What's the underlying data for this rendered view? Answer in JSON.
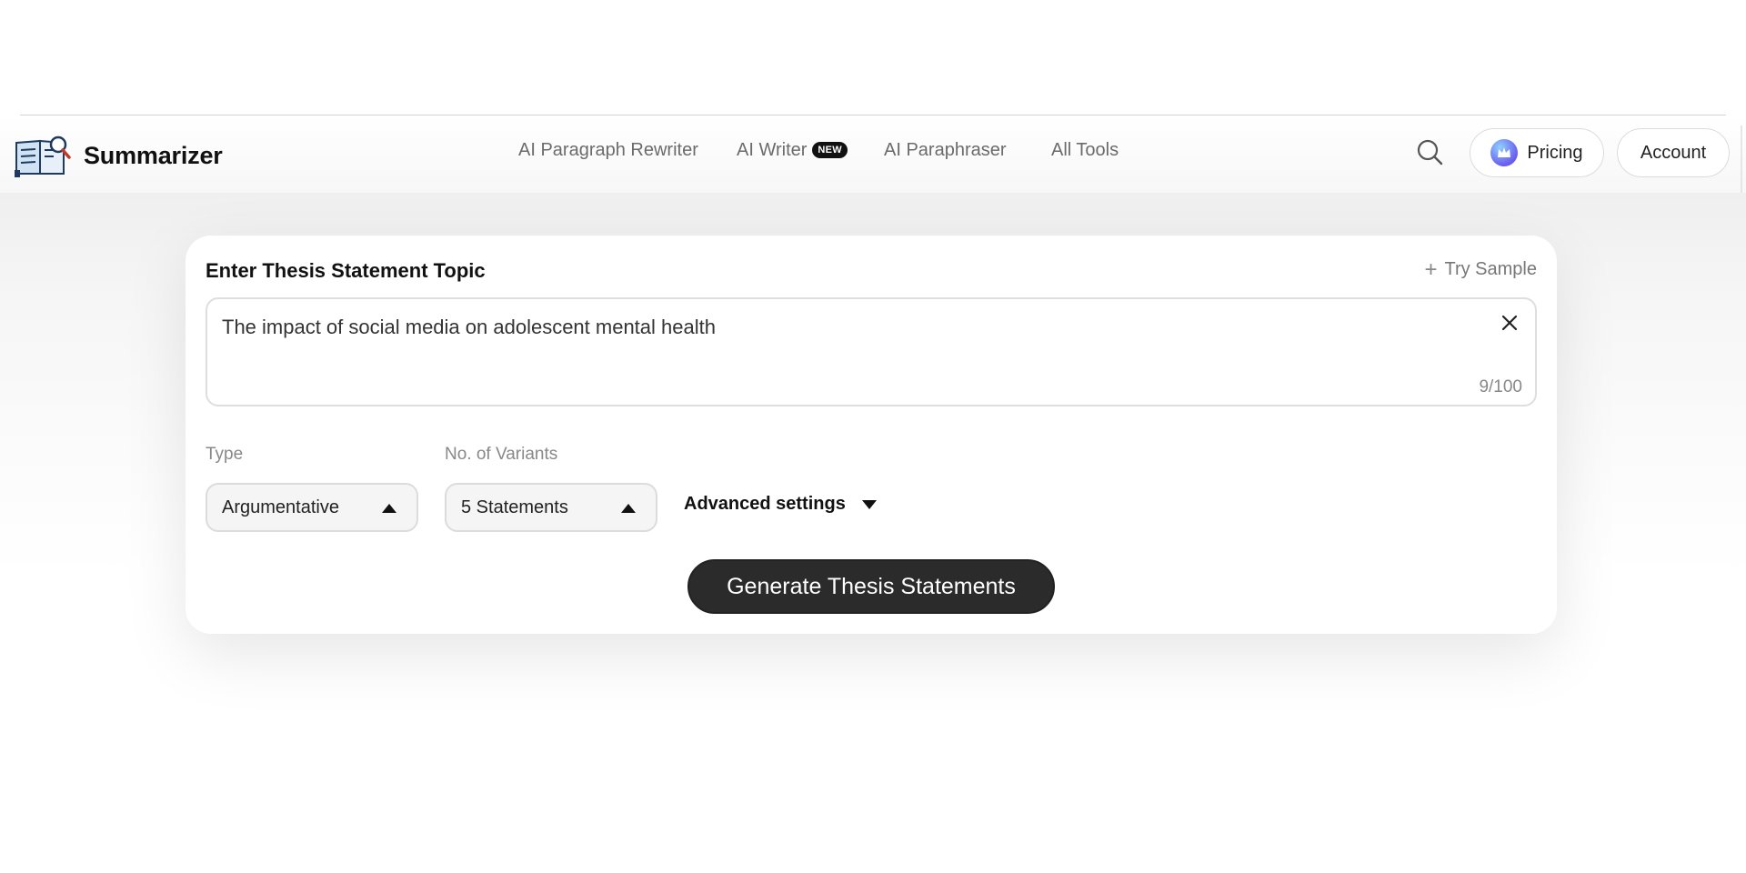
{
  "header": {
    "brand": "Summarizer",
    "nav": [
      {
        "label": "AI Paragraph Rewriter"
      },
      {
        "label": "AI Writer",
        "badge": "NEW"
      },
      {
        "label": "AI Paraphraser"
      },
      {
        "label": "All Tools"
      }
    ],
    "pricing_label": "Pricing",
    "account_label": "Account"
  },
  "form": {
    "title": "Enter Thesis Statement Topic",
    "try_sample": "Try Sample",
    "topic_value": "The impact of social media on adolescent mental health",
    "counter": "9/100",
    "type_label": "Type",
    "type_value": "Argumentative",
    "variants_label": "No. of Variants",
    "variants_value": "5 Statements",
    "advanced_label": "Advanced settings",
    "generate_label": "Generate Thesis Statements"
  },
  "colors": {
    "primary_button": "#2b2b2b",
    "badge": "#111111"
  },
  "icons": [
    "book-logo-icon",
    "search-icon",
    "crown-icon",
    "plus-icon",
    "close-icon",
    "caret-up-icon",
    "caret-down-icon"
  ]
}
